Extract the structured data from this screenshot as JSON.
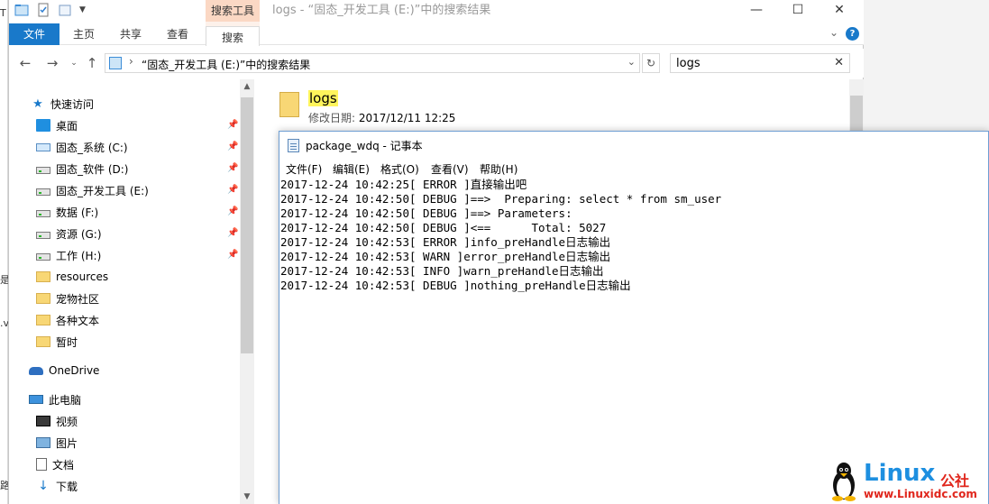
{
  "explorer": {
    "title": "logs - “固态_开发工具 (E:)”中的搜索结果",
    "context_tab_header": "搜索工具",
    "ribbon_tabs": [
      "文件",
      "主页",
      "共享",
      "查看",
      "搜索"
    ],
    "window_controls": {
      "minimize": "—",
      "maximize": "☐",
      "close": "✕"
    },
    "help": "?",
    "address": "“固态_开发工具 (E:)”中的搜索结果",
    "search_value": "logs",
    "nav": {
      "quick_access": "快速访问",
      "items": [
        {
          "label": "桌面",
          "pinned": true
        },
        {
          "label": "固态_系统 (C:)",
          "pinned": true
        },
        {
          "label": "固态_软件 (D:)",
          "pinned": true
        },
        {
          "label": "固态_开发工具 (E:)",
          "pinned": true
        },
        {
          "label": "数据 (F:)",
          "pinned": true
        },
        {
          "label": "资源 (G:)",
          "pinned": true
        },
        {
          "label": "工作 (H:)",
          "pinned": true
        },
        {
          "label": "resources",
          "pinned": false
        },
        {
          "label": "宠物社区",
          "pinned": false
        },
        {
          "label": "各种文本",
          "pinned": false
        },
        {
          "label": "暂时",
          "pinned": false
        }
      ],
      "onedrive": "OneDrive",
      "this_pc": "此电脑",
      "pc_items": [
        "视频",
        "图片",
        "文档",
        "下载"
      ]
    },
    "result": {
      "name": "logs",
      "date_label": "修改日期:",
      "date_value": "2017/12/11 12:25"
    }
  },
  "notepad": {
    "title": "package_wdq - 记事本",
    "menu": [
      "文件(F)",
      "编辑(E)",
      "格式(O)",
      "查看(V)",
      "帮助(H)"
    ],
    "lines": [
      "2017-12-24 10:42:25[ ERROR ]直接输出吧",
      "2017-12-24 10:42:50[ DEBUG ]==>  Preparing: select * from sm_user",
      "2017-12-24 10:42:50[ DEBUG ]==> Parameters: ",
      "2017-12-24 10:42:50[ DEBUG ]<==      Total: 5027",
      "2017-12-24 10:42:53[ ERROR ]info_preHandle日志输出",
      "2017-12-24 10:42:53[ WARN ]error_preHandle日志输出",
      "2017-12-24 10:42:53[ INFO ]warn_preHandle日志输出",
      "2017-12-24 10:42:53[ DEBUG ]nothing_preHandle日志输出"
    ]
  },
  "watermark": {
    "brand": "Linux",
    "suffix": "公社",
    "url": "www.Linuxidc.com"
  },
  "left_edge_marks": [
    "T",
    "是",
    ".v",
    "路"
  ]
}
